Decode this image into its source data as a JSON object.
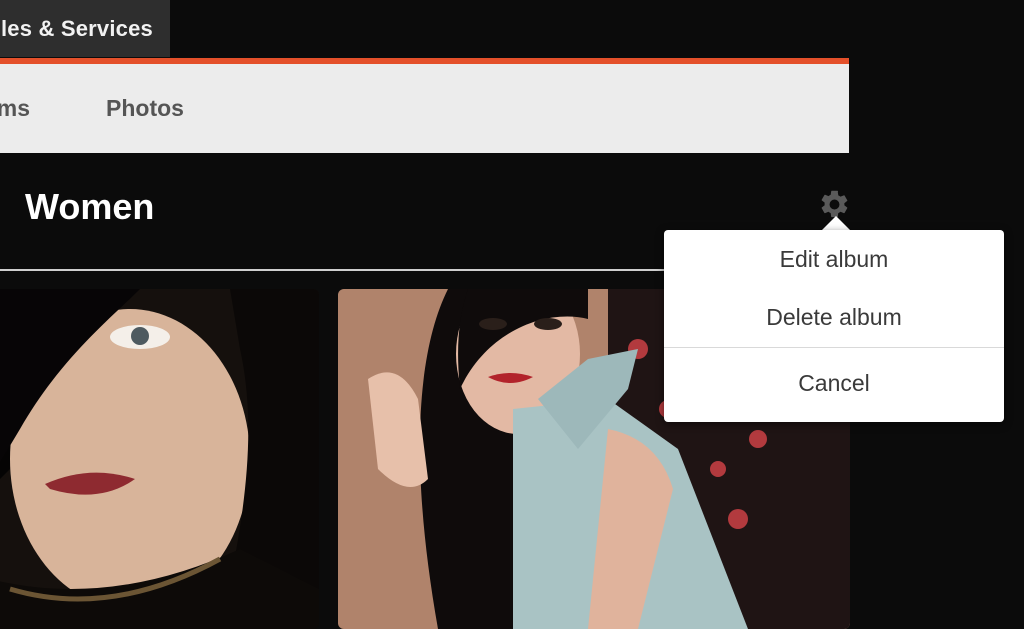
{
  "header": {
    "tab_label": "les & Services"
  },
  "nav": {
    "albums_label": "ms",
    "photos_label": "Photos"
  },
  "album": {
    "title": "Women"
  },
  "menu": {
    "edit_label": "Edit album",
    "delete_label": "Delete album",
    "cancel_label": "Cancel"
  },
  "icons": {
    "settings": "gear-icon"
  },
  "colors": {
    "accent": "#e4502a",
    "background": "#0b0b0b",
    "nav_background": "#ececec",
    "tab_background": "#2e2e2e"
  }
}
